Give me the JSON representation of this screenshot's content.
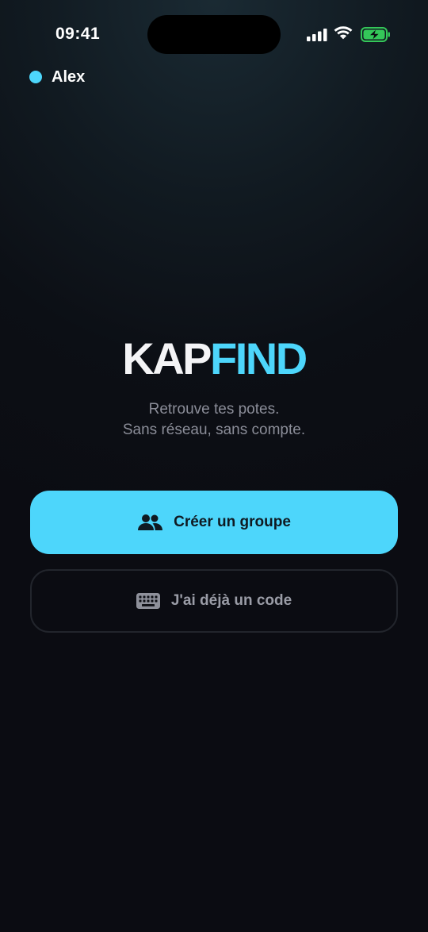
{
  "status_bar": {
    "time": "09:41",
    "icons": [
      "cellular-signal-icon",
      "wifi-icon",
      "battery-charging-icon"
    ]
  },
  "user": {
    "name": "Alex",
    "status_color": "#4dd6fb"
  },
  "logo": {
    "part_1": "KAP",
    "part_2": "FIND",
    "colors": {
      "part_1": "#f4f4f6",
      "part_2": "#4dd6fb"
    }
  },
  "tagline": {
    "line_1": "Retrouve tes potes.",
    "line_2": "Sans réseau, sans compte."
  },
  "actions": {
    "create_group": {
      "label": "Créer un groupe",
      "icon": "group-icon"
    },
    "have_code": {
      "label": "J'ai déjà un code",
      "icon": "keyboard-icon"
    }
  },
  "colors": {
    "accent": "#4dd6fb",
    "background": "#0b0c12",
    "battery": "#34c759"
  }
}
